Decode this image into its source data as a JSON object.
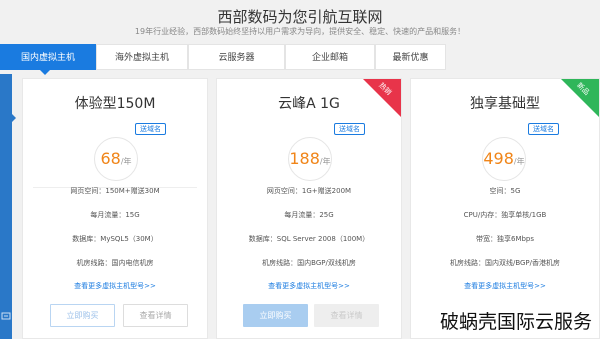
{
  "header": {
    "title": "西部数码为您引航互联网",
    "subtitle": "19年行业经验，西部数码始终坚持以用户需求为导向，提供安全、稳定、快速的产品和服务！"
  },
  "tabs": [
    {
      "label": "国内虚拟主机",
      "active": true
    },
    {
      "label": "海外虚拟主机",
      "active": false
    },
    {
      "label": "云服务器",
      "active": false
    },
    {
      "label": "企业邮箱",
      "active": false
    },
    {
      "label": "最新优惠",
      "active": false
    }
  ],
  "cards": [
    {
      "title": "体验型150M",
      "tag": "送域名",
      "price": "68",
      "unit": "/年",
      "specs": [
        "网页空间：150M+赠送30M",
        "每月流量：15G",
        "数据库：MySQL5（30M）",
        "机房线路：国内电信机房"
      ],
      "more": "查看更多虚拟主机型号>>",
      "buy": "立即购买",
      "detail": "查看详情"
    },
    {
      "title": "云峰A 1G",
      "tag": "送域名",
      "price": "188",
      "unit": "/年",
      "corner": "热销",
      "specs": [
        "网页空间：1G+赠送200M",
        "每月流量：25G",
        "数据库：SQL Server 2008（100M）",
        "机房线路：国内BGP/双线机房"
      ],
      "more": "查看更多虚拟主机型号>>",
      "buy": "立即购买",
      "detail": "查看详情"
    },
    {
      "title": "独享基础型",
      "tag": "送域名",
      "price": "498",
      "unit": "/年",
      "corner": "新品",
      "specs": [
        "空间：5G",
        "CPU/内存：独享单核/1GB",
        "带宽：独享6Mbps",
        "机房线路：国内双线/BGP/香港机房"
      ],
      "more": "查看更多虚拟主机型号>>",
      "buy": "立即购买",
      "detail": "查看详情"
    }
  ],
  "watermark": "破蜗壳国际云服务",
  "colors": {
    "accent": "#1a7be0",
    "price": "#f08519",
    "hot": "#e8344a",
    "new": "#2fb65a"
  }
}
